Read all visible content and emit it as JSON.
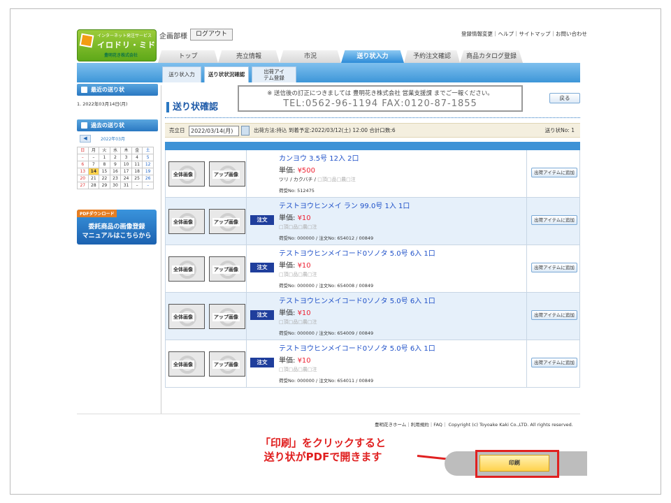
{
  "logo": {
    "line1": "インターネット発注サービス",
    "line2": "イロドリ・ミドリ",
    "line3": "豊明花き株式会社"
  },
  "header": {
    "account": "企画部様",
    "logout": "ログアウト",
    "links": "登録情報変更｜ヘルプ｜サイトマップ｜お問い合わせ"
  },
  "tabs": [
    "トップ",
    "売立情報",
    "市況",
    "送り状入力",
    "予約注文確認",
    "商品カタログ登録"
  ],
  "subtabs": [
    "送り状入力",
    "送り状状況確認",
    "出荷アイ",
    "テム登録"
  ],
  "sidebar": {
    "recent_title": "最近の送り状",
    "recent_item": "1. 2022年03月14日(月)",
    "past_title": "過去の送り状",
    "prev_arrow": "◀",
    "month": "2022年03月",
    "weekdays": [
      "日",
      "月",
      "火",
      "水",
      "木",
      "金",
      "土"
    ],
    "weeks": [
      [
        "–",
        "–",
        "1",
        "2",
        "3",
        "4",
        "5"
      ],
      [
        "6",
        "7",
        "8",
        "9",
        "10",
        "11",
        "12"
      ],
      [
        "13",
        "14",
        "15",
        "16",
        "17",
        "18",
        "19"
      ],
      [
        "20",
        "21",
        "22",
        "23",
        "24",
        "25",
        "26"
      ],
      [
        "27",
        "28",
        "29",
        "30",
        "31",
        "–",
        "–"
      ]
    ],
    "pdf_tag": "PDFダウンロード",
    "pdf_line1": "委託商品の画像登録",
    "pdf_line2": "マニュアルはこちらから"
  },
  "main": {
    "title": "送り状確認",
    "notice_line1": "※ 送信後の訂正につきましては 豊明花き株式会社 営業支援課 までご一報ください。",
    "notice_line2": "TEL:0562-96-1194 FAX:0120-87-1855",
    "back": "戻る",
    "sale_date_label": "売立日",
    "sale_date": "2022/03/14(月)",
    "ship_info": "出荷方法:持込 到着予定:2022/03/12(土) 12:00 合計口数:6",
    "invoice_no": "送り状No: 1"
  },
  "items": [
    {
      "name": "カンヨウ 3.5号 12入 2口",
      "price_label": "単価:",
      "price": "¥500",
      "opts_pre": "ツリ / カクバチ / ",
      "opts": "□頂□品□農□注",
      "nums": "荷受No: 512475",
      "order": ""
    },
    {
      "name": "テストヨウヒンメイ ラン 99.0号 1入 1口",
      "price_label": "単価:",
      "price": "¥10",
      "opts_pre": "",
      "opts": "□頂□品□農□注",
      "nums": "荷受No: 000000 / 注文No: 654012 / 00849",
      "order": "注文"
    },
    {
      "name": "テストヨウヒンメイコード0ソノタ 5.0号 6入 1口",
      "price_label": "単価:",
      "price": "¥10",
      "opts_pre": "",
      "opts": "□頂□品□農□注",
      "nums": "荷受No: 000000 / 注文No: 654008 / 00849",
      "order": "注文"
    },
    {
      "name": "テストヨウヒンメイコード0ソノタ 5.0号 6入 1口",
      "price_label": "単価:",
      "price": "¥10",
      "opts_pre": "",
      "opts": "□頂□品□農□注",
      "nums": "荷受No: 000000 / 注文No: 654009 / 00849",
      "order": "注文"
    },
    {
      "name": "テストヨウヒンメイコード0ソノタ 5.0号 6入 1口",
      "price_label": "単価:",
      "price": "¥10",
      "opts_pre": "",
      "opts": "□頂□品□農□注",
      "nums": "荷受No: 000000 / 注文No: 654011 / 00849",
      "order": "注文"
    }
  ],
  "row_labels": {
    "full_image": "全体画像",
    "up_image": "アップ画像",
    "add_button": "出荷アイテムに追加"
  },
  "footer": "豊明花きホーム｜利用規約｜FAQ｜ Copyright (c) Toyoake Kaki Co.,LTD. All rights reserved.",
  "callout": {
    "line1": "「印刷」をクリックすると",
    "line2": "送り状がPDFで開きます"
  },
  "print_button": "印刷",
  "colors": {
    "accent": "#2a78c2",
    "callout": "#e02020",
    "price": "#e22233"
  }
}
